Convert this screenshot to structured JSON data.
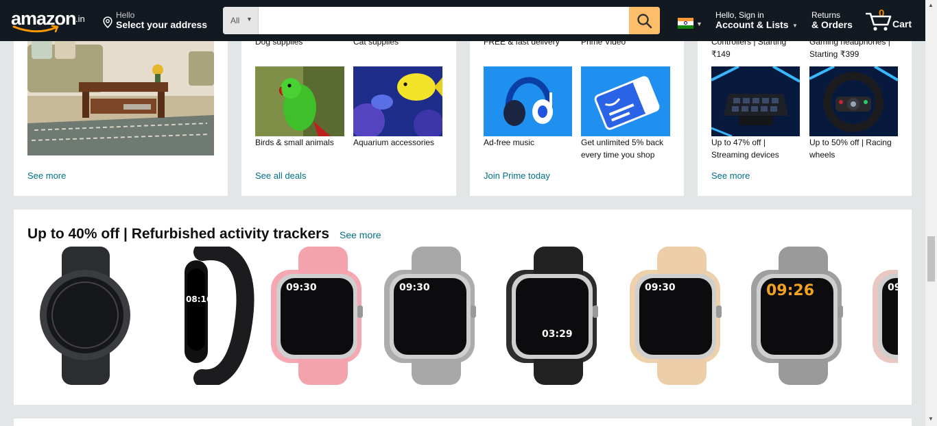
{
  "header": {
    "logo_text": "amazon",
    "logo_tld": ".in",
    "address_hello": "Hello",
    "address_cta": "Select your address",
    "search_category": "All",
    "search_placeholder": "",
    "account_hello": "Hello, Sign in",
    "account_label": "Account & Lists",
    "returns_l1": "Returns",
    "returns_l2": "& Orders",
    "cart_count": "0",
    "cart_label": "Cart",
    "colors": {
      "nav_bg": "#131921",
      "search_btn": "#febd69",
      "cart_count": "#f08804"
    }
  },
  "cards": [
    {
      "see_more": "See more"
    },
    {
      "top_captions": [
        "Dog supplies",
        "Cat supplies"
      ],
      "tiles": [
        {
          "caption": "Birds & small animals",
          "icon": "parrot-image"
        },
        {
          "caption": "Aquarium accessories",
          "icon": "fish-image"
        }
      ],
      "see_more": "See all deals"
    },
    {
      "top_captions": [
        "FREE & fast delivery",
        "Prime Video"
      ],
      "tiles": [
        {
          "caption": "Ad-free music",
          "icon": "headphones-image"
        },
        {
          "caption": "Get unlimited 5% back every time you shop",
          "icon": "credit-card-image"
        }
      ],
      "see_more": "Join Prime today"
    },
    {
      "top_captions": [
        "Controllers | Starting ₹149",
        "Gaming headphones | Starting ₹399"
      ],
      "tiles": [
        {
          "caption": "Up to 47% off | Streaming devices",
          "icon": "stream-deck-image"
        },
        {
          "caption": "Up to 50% off | Racing wheels",
          "icon": "racing-wheel-image"
        }
      ],
      "see_more": "See more"
    }
  ],
  "carousel": {
    "title": "Up to 40% off | Refurbished activity trackers",
    "see_more": "See more",
    "watches": [
      {
        "icon": "round-smartwatch-image",
        "strap": "#2b2d31",
        "face_time": ""
      },
      {
        "icon": "fitness-band-image",
        "strap": "#1c1c1e",
        "face_time": "08:16"
      },
      {
        "icon": "pink-smartwatch-image",
        "strap": "#f4a3ad",
        "face_time": "09:30"
      },
      {
        "icon": "grey-smartwatch-image",
        "strap": "#a8a8a8",
        "face_time": "09:30"
      },
      {
        "icon": "black-smartwatch-image",
        "strap": "#222",
        "face_time": "03:29"
      },
      {
        "icon": "beige-smartwatch-image",
        "strap": "#eccfa8",
        "face_time": "09:30"
      },
      {
        "icon": "silver-smartwatch-image",
        "strap": "#9a9a9a",
        "face_time": "09:26"
      },
      {
        "icon": "rose-smartwatch-image",
        "strap": "#e8c4c0",
        "face_time": "09"
      }
    ]
  }
}
